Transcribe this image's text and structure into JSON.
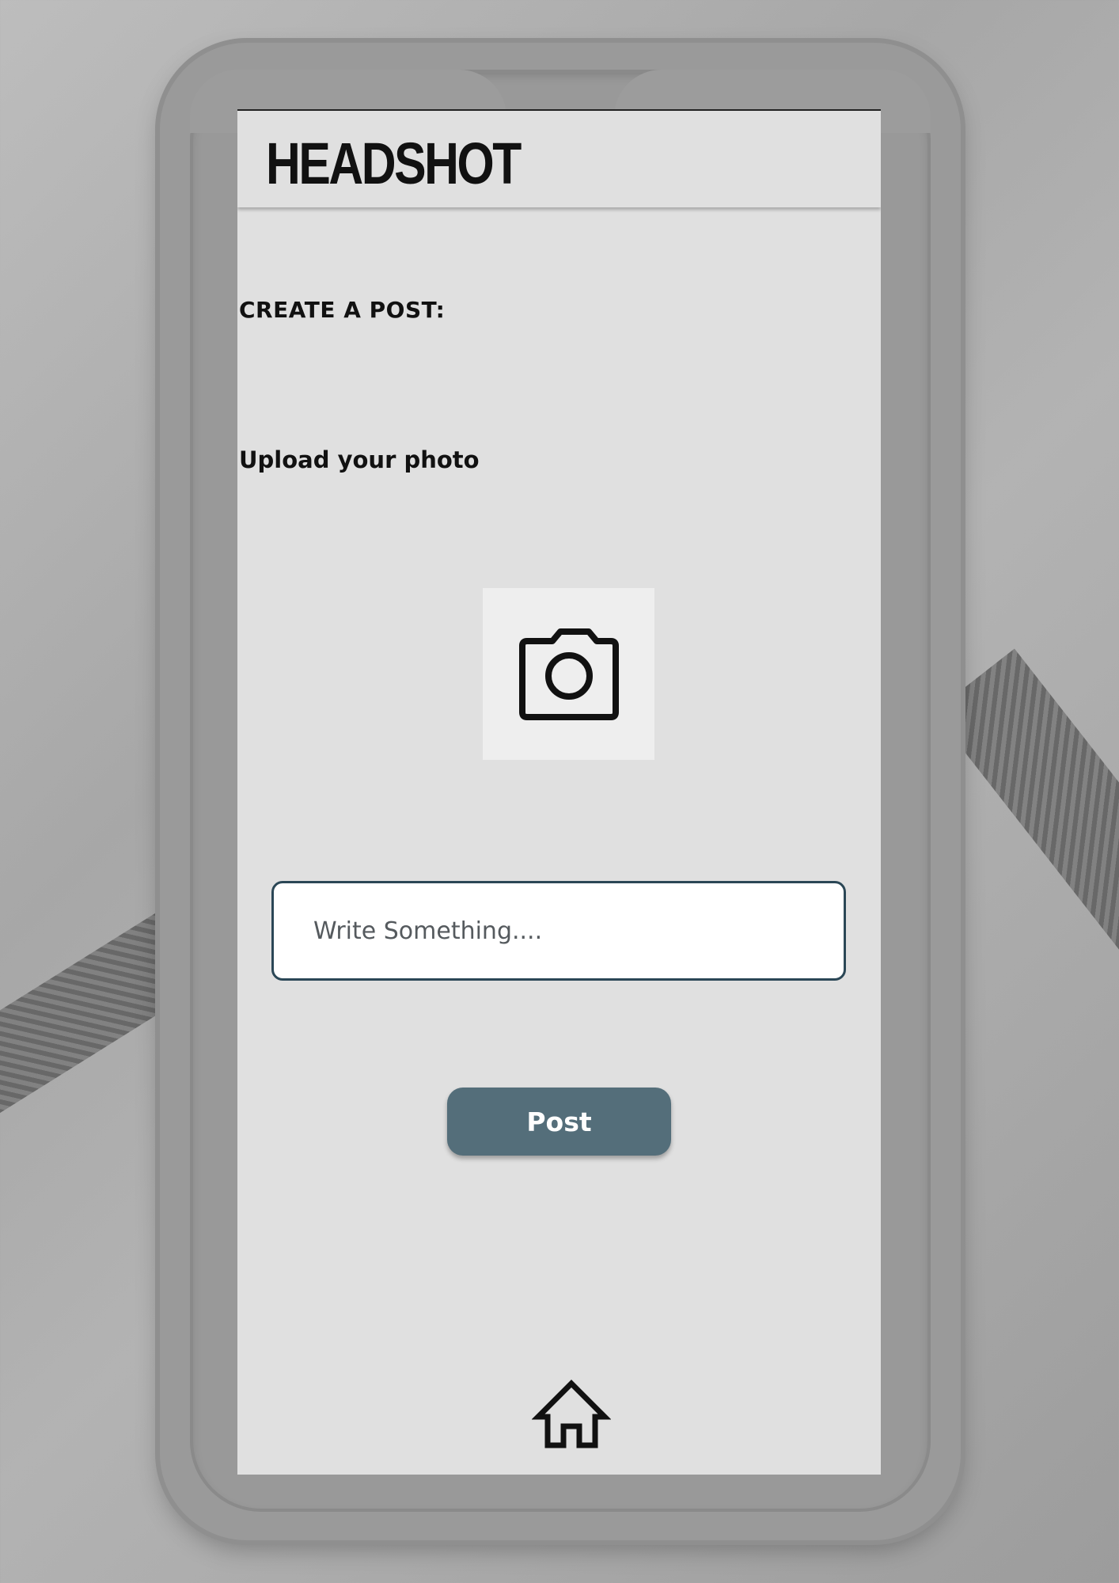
{
  "app": {
    "title": "HEADSHOT"
  },
  "create_post": {
    "section_label": "CREATE A POST:",
    "upload_label": "Upload your photo",
    "camera_icon": "camera-icon",
    "text_input_placeholder": "Write Something....",
    "text_input_value": "",
    "post_button_label": "Post"
  },
  "bottom_nav": {
    "home_icon": "home-icon"
  },
  "colors": {
    "screen_background": "#e0e0e0",
    "post_button": "#546e7a",
    "input_border": "#2b4756",
    "camera_tile": "#eeeeee"
  }
}
